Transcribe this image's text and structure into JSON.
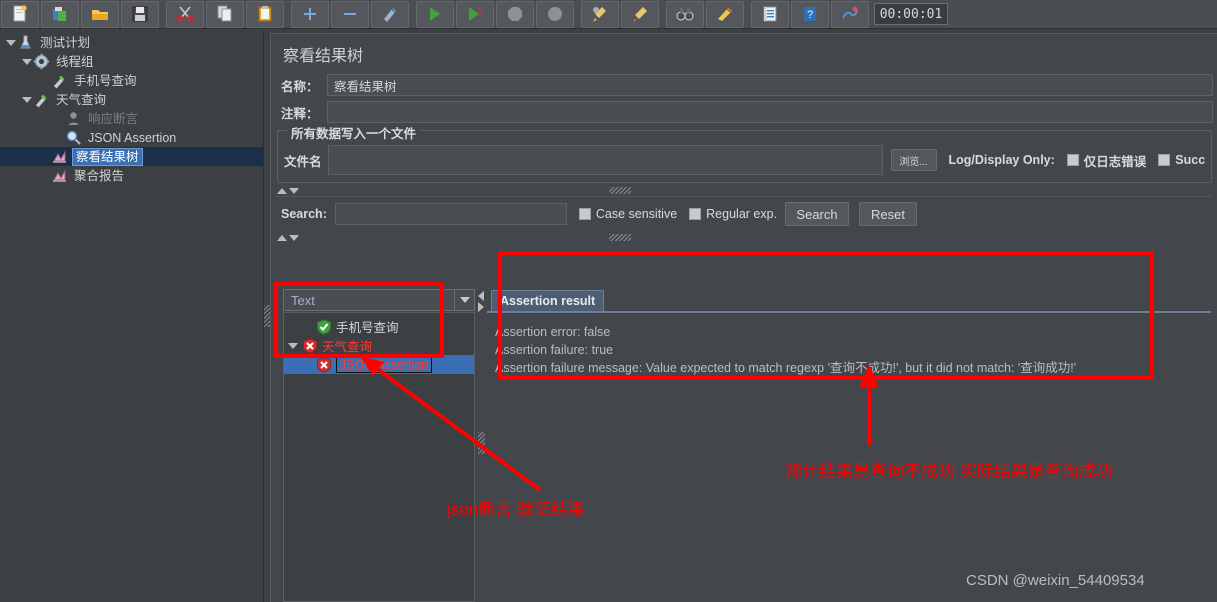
{
  "toolbar": {
    "buttons": [
      {
        "name": "new-test-plan",
        "icon": "new-file-icon"
      },
      {
        "name": "templates",
        "icon": "templates-icon"
      },
      {
        "name": "open",
        "icon": "open-folder-icon"
      },
      {
        "name": "save",
        "icon": "save-disk-icon"
      },
      {
        "name": "cut",
        "icon": "scissors-icon"
      },
      {
        "name": "copy",
        "icon": "copy-icon"
      },
      {
        "name": "paste",
        "icon": "clipboard-icon"
      },
      {
        "name": "expand-all",
        "icon": "plus-icon"
      },
      {
        "name": "collapse-all",
        "icon": "minus-icon"
      },
      {
        "name": "toggle",
        "icon": "toggle-pencil-icon"
      },
      {
        "name": "start",
        "icon": "green-play-icon"
      },
      {
        "name": "start-no-pauses",
        "icon": "green-play-nopause-icon"
      },
      {
        "name": "stop",
        "icon": "stop-octagon-icon"
      },
      {
        "name": "shutdown",
        "icon": "shutdown-icon"
      },
      {
        "name": "clear",
        "icon": "broom-gear-icon"
      },
      {
        "name": "clear-all",
        "icon": "broom-icon"
      },
      {
        "name": "search",
        "icon": "binoculars-icon"
      },
      {
        "name": "reset-search",
        "icon": "reset-search-icon"
      },
      {
        "name": "function-helper",
        "icon": "notepad-icon"
      },
      {
        "name": "help",
        "icon": "help-book-icon"
      },
      {
        "name": "undo-redo",
        "icon": "scribble-icon"
      }
    ],
    "timer": "00:00:01"
  },
  "tree": {
    "items": [
      {
        "label": "测试计划",
        "icon": "test-plan-icon",
        "indent": 0,
        "toggle": "open",
        "state": "normal"
      },
      {
        "label": "线程组",
        "icon": "thread-group-gear-icon",
        "indent": 1,
        "toggle": "open",
        "state": "normal"
      },
      {
        "label": "手机号查询",
        "icon": "http-sampler-icon",
        "indent": 2,
        "toggle": "none",
        "state": "normal"
      },
      {
        "label": "天气查询",
        "icon": "http-sampler-icon",
        "indent": 2,
        "toggle": "open",
        "state": "normal"
      },
      {
        "label": "响应断言",
        "icon": "assertion-icon",
        "indent": 3,
        "toggle": "none",
        "state": "disabled"
      },
      {
        "label": "JSON Assertion",
        "icon": "json-assertion-magnifier-icon",
        "indent": 3,
        "toggle": "none",
        "state": "normal"
      },
      {
        "label": "察看结果树",
        "icon": "view-results-tree-icon",
        "indent": 2,
        "toggle": "none",
        "state": "selected"
      },
      {
        "label": "聚合报告",
        "icon": "aggregate-report-icon",
        "indent": 2,
        "toggle": "none",
        "state": "normal"
      }
    ]
  },
  "main": {
    "title": "察看结果树",
    "name_label": "名称：",
    "name_value": "察看结果树",
    "comment_label": "注释：",
    "comment_value": "",
    "groupbox_title": "所有数据写入一个文件",
    "file_label": "文件名",
    "file_value": "",
    "browse_label": "浏览...",
    "logdisplay_label": "Log/Display Only:",
    "checkbox_errors_label": "仅日志错误",
    "checkbox_success_label": "Succ",
    "search": {
      "label": "Search:",
      "value": "",
      "case_sensitive_label": "Case sensitive",
      "regular_exp_label": "Regular exp.",
      "search_button": "Search",
      "reset_button": "Reset"
    },
    "renderer_selected": "Text",
    "result_tree": [
      {
        "label": "手机号查询",
        "icon": "green-check-shield-icon",
        "indent": 1,
        "toggle": "none",
        "state": "ok"
      },
      {
        "label": "天气查询",
        "icon": "red-x-shield-icon",
        "indent": 0,
        "toggle": "open",
        "state": "error"
      },
      {
        "label": "JSON Assertion",
        "icon": "red-x-shield-icon",
        "indent": 1,
        "toggle": "none",
        "state": "selected-error"
      }
    ],
    "detail": {
      "tab_label": "Assertion result",
      "lines": [
        "Assertion error: false",
        "Assertion failure: true",
        "Assertion failure message: Value expected to match regexp '查询不成功!', but it did not match: '查询成功!'"
      ]
    }
  },
  "annotations": {
    "note_left": "json断言  验证结果",
    "note_right": "预计结果是查询不成功   实际结果是查询成功",
    "color": "#ff0000"
  },
  "watermark": "CSDN @weixin_54409534"
}
